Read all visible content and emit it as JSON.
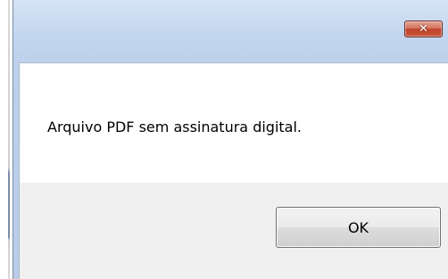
{
  "dialog": {
    "message": "Arquivo PDF sem assinatura digital.",
    "ok_label": "OK",
    "close_glyph": "✕"
  },
  "icons": {
    "close": "close-icon"
  },
  "colors": {
    "titlebar": "#c3d6ef",
    "close_button": "#c9553a",
    "content_bg": "#f0f0f0",
    "message_bg": "#ffffff"
  }
}
